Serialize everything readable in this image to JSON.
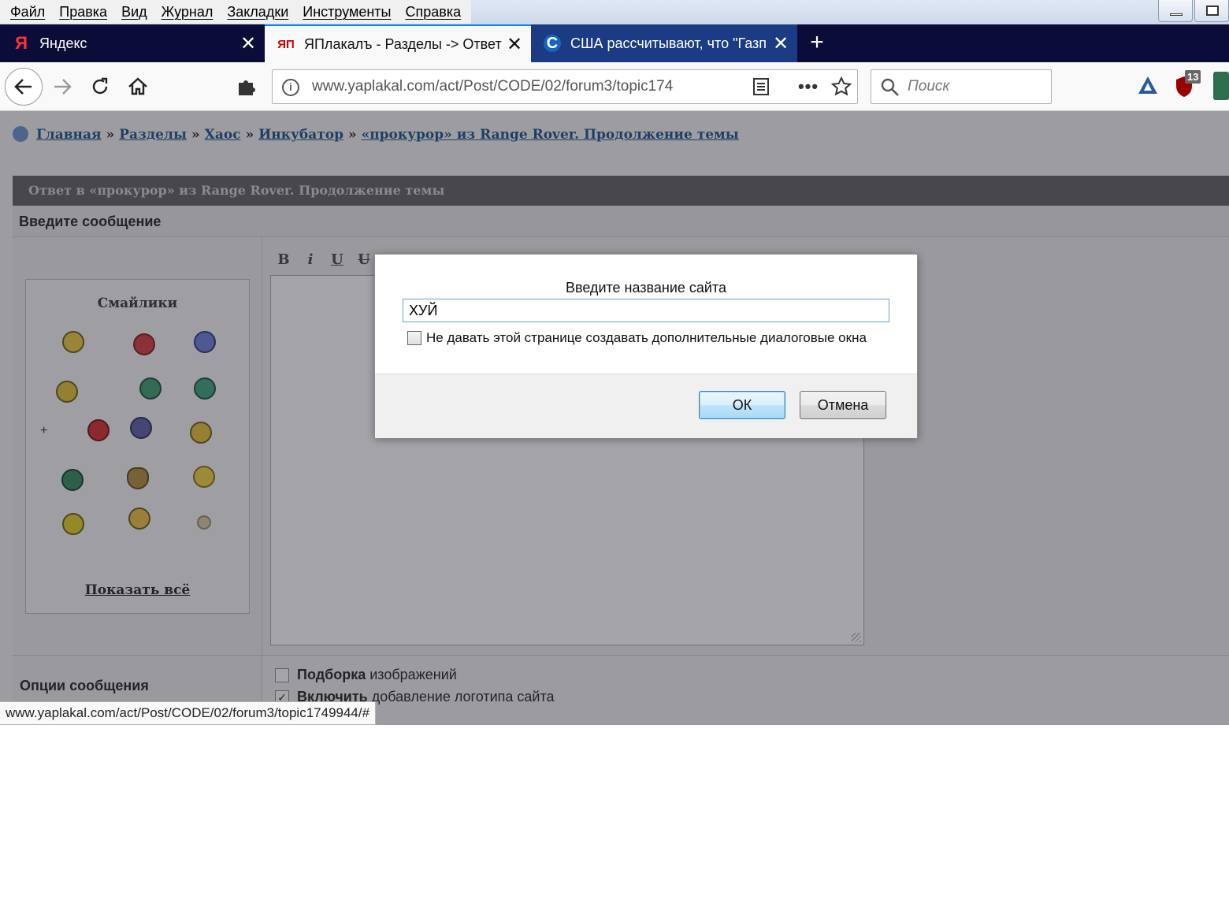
{
  "menubar": {
    "items": [
      "Файл",
      "Правка",
      "Вид",
      "Журнал",
      "Закладки",
      "Инструменты",
      "Справка"
    ]
  },
  "tabs": [
    {
      "title": "Яндекс",
      "favicon": "Я"
    },
    {
      "title": "ЯПлакалъ - Разделы -> Ответ",
      "favicon": "ЯП"
    },
    {
      "title": "США рассчитывают, что \"Газп",
      "favicon": "C"
    }
  ],
  "navbar": {
    "url": "www.yaplakal.com/act/Post/CODE/02/forum3/topic174",
    "search_placeholder": "Поиск",
    "badge_count": "13"
  },
  "page": {
    "breadcrumb": [
      "Главная",
      "Разделы",
      "Хаос",
      "Инкубатор",
      "«прокурор» из Range Rover. Продолжение темы"
    ],
    "breadcrumb_sep": "»",
    "panel_title": "Ответ в «прокурор» из Range Rover. Продолжение темы",
    "enter_message": "Введите сообщение",
    "smileys_title": "Смайлики",
    "smileys_plus": "+",
    "show_all": "Показать всё",
    "toolbar": [
      "B",
      "i",
      "U",
      "U"
    ],
    "options_label": "Опции сообщения",
    "option1_bold": "Подборка",
    "option1_rest": "изображений",
    "option2_bold": "Включить",
    "option2_rest": "добавление логотипа сайта"
  },
  "dialog": {
    "message": "Введите название сайта",
    "input_value": "ХУЙ",
    "checkbox_label": "Не давать этой странице создавать дополнительные диалоговые окна",
    "ok_label": "ОК",
    "cancel_label": "Отмена"
  },
  "status_url": "www.yaplakal.com/act/Post/CODE/02/forum3/topic1749944/#",
  "colors": {
    "tabbar": "#0c0c38",
    "accent": "#0a84ff",
    "link": "#1a4f8a"
  }
}
